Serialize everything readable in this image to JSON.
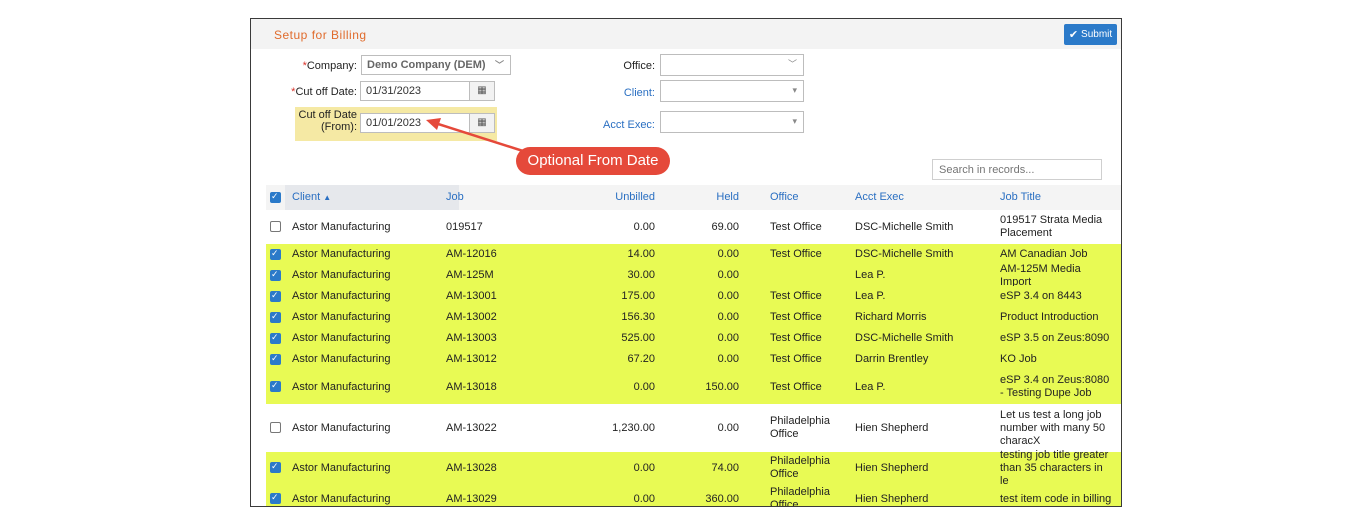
{
  "header": {
    "title": "Setup for Billing",
    "submit_label": "Submit"
  },
  "form": {
    "company_label": "Company:",
    "company_value": "Demo Company (DEM)",
    "cutoff_label": "Cut off Date:",
    "cutoff_value": "01/31/2023",
    "cutoff_from_label_1": "Cut off Date",
    "cutoff_from_label_2": "(From):",
    "cutoff_from_value": "01/01/2023",
    "office_label": "Office:",
    "client_label": "Client:",
    "acct_exec_label": "Acct Exec:",
    "required_mark": "*"
  },
  "callout": "Optional From Date",
  "search": {
    "placeholder": "Search in records..."
  },
  "table": {
    "headers": {
      "client": "Client",
      "job": "Job",
      "unbilled": "Unbilled",
      "held": "Held",
      "office": "Office",
      "acct_exec": "Acct Exec",
      "job_title": "Job Title"
    },
    "sort_indicator": "▲",
    "rows": [
      {
        "checked": false,
        "client": "Astor Manufacturing",
        "job": "019517",
        "unbilled": "0.00",
        "held": "69.00",
        "office": "Test Office",
        "acct_exec": "DSC-Michelle Smith",
        "job_title": "019517 Strata Media Placement"
      },
      {
        "checked": true,
        "client": "Astor Manufacturing",
        "job": "AM-12016",
        "unbilled": "14.00",
        "held": "0.00",
        "office": "Test Office",
        "acct_exec": "DSC-Michelle Smith",
        "job_title": "AM Canadian Job"
      },
      {
        "checked": true,
        "client": "Astor Manufacturing",
        "job": "AM-125M",
        "unbilled": "30.00",
        "held": "0.00",
        "office": "",
        "acct_exec": "Lea P.",
        "job_title": "AM-125M Media Import"
      },
      {
        "checked": true,
        "client": "Astor Manufacturing",
        "job": "AM-13001",
        "unbilled": "175.00",
        "held": "0.00",
        "office": "Test Office",
        "acct_exec": "Lea P.",
        "job_title": "eSP 3.4 on 8443"
      },
      {
        "checked": true,
        "client": "Astor Manufacturing",
        "job": "AM-13002",
        "unbilled": "156.30",
        "held": "0.00",
        "office": "Test Office",
        "acct_exec": "Richard Morris",
        "job_title": "Product Introduction"
      },
      {
        "checked": true,
        "client": "Astor Manufacturing",
        "job": "AM-13003",
        "unbilled": "525.00",
        "held": "0.00",
        "office": "Test Office",
        "acct_exec": "DSC-Michelle Smith",
        "job_title": "eSP 3.5 on Zeus:8090"
      },
      {
        "checked": true,
        "client": "Astor Manufacturing",
        "job": "AM-13012",
        "unbilled": "67.20",
        "held": "0.00",
        "office": "Test Office",
        "acct_exec": "Darrin Brentley",
        "job_title": "KO Job"
      },
      {
        "checked": true,
        "client": "Astor Manufacturing",
        "job": "AM-13018",
        "unbilled": "0.00",
        "held": "150.00",
        "office": "Test Office",
        "acct_exec": "Lea P.",
        "job_title": "eSP 3.4 on Zeus:8080 - Testing Dupe Job"
      },
      {
        "checked": false,
        "client": "Astor Manufacturing",
        "job": "AM-13022",
        "unbilled": "1,230.00",
        "held": "0.00",
        "office": "Philadelphia Office",
        "acct_exec": "Hien Shepherd",
        "job_title": "Let us test a long job number with many 50 characX"
      },
      {
        "checked": true,
        "client": "Astor Manufacturing",
        "job": "AM-13028",
        "unbilled": "0.00",
        "held": "74.00",
        "office": "Philadelphia Office",
        "acct_exec": "Hien Shepherd",
        "job_title": "testing job title greater than 35 characters in le"
      },
      {
        "checked": true,
        "client": "Astor Manufacturing",
        "job": "AM-13029",
        "unbilled": "0.00",
        "held": "360.00",
        "office": "Philadelphia Office",
        "acct_exec": "Hien Shepherd",
        "job_title": "test item code in billing"
      }
    ]
  }
}
